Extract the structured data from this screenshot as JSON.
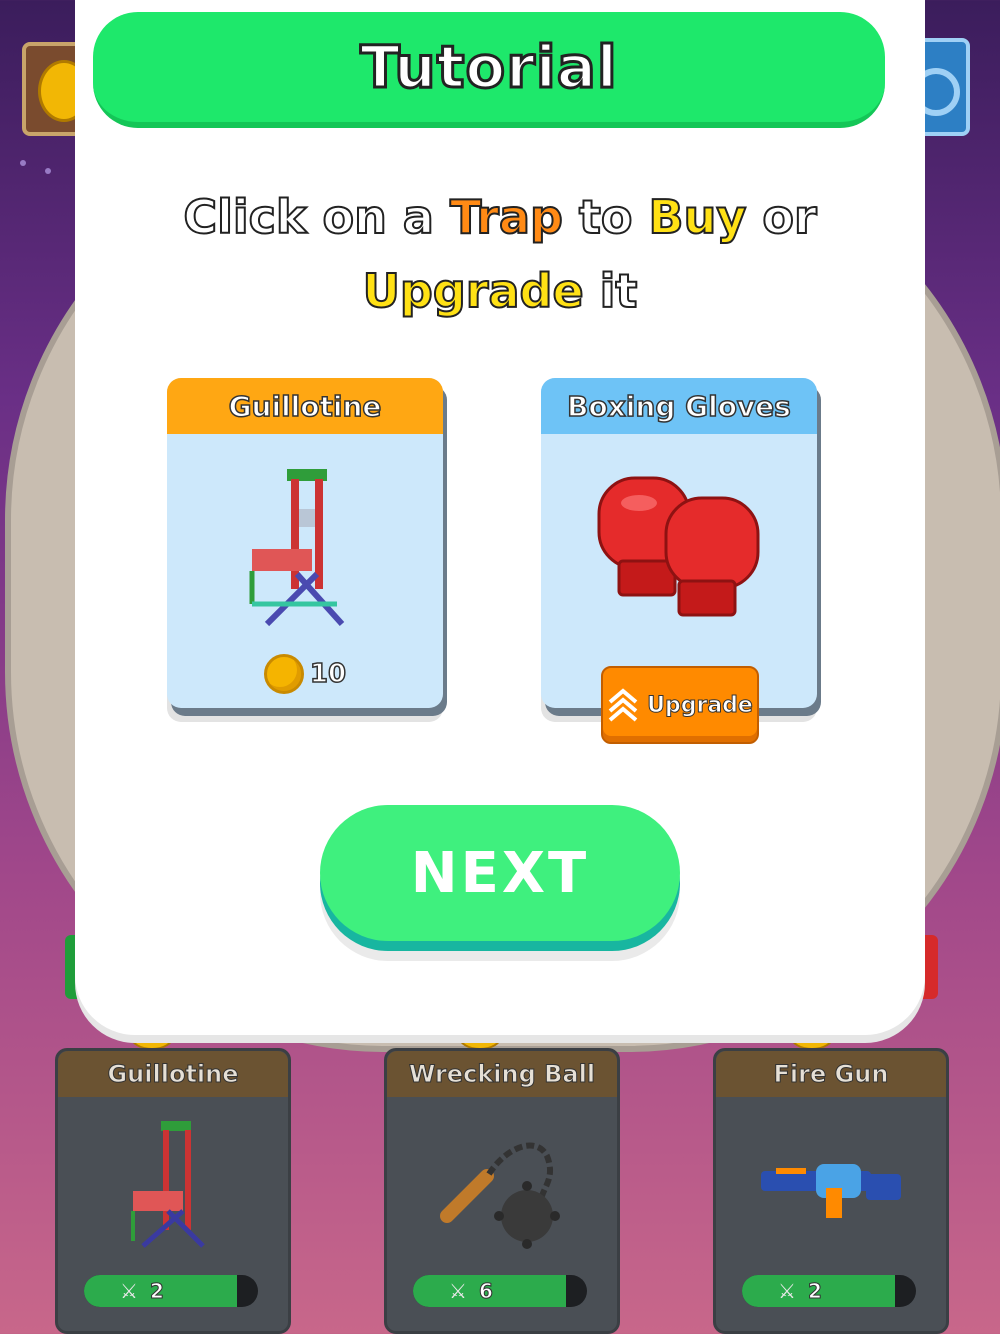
{
  "modal": {
    "title": "Tutorial",
    "instruction": {
      "part1": "Click on a ",
      "trap": "Trap",
      "part2": " to ",
      "buy": "Buy",
      "part3": " or",
      "upgrade": "Upgrade",
      "part4": " it"
    },
    "cards": [
      {
        "name": "Guillotine",
        "price": "10",
        "icon": "coin-icon"
      },
      {
        "name": "Boxing Gloves",
        "button": "Upgrade",
        "icon": "upgrade-arrows-icon"
      }
    ],
    "next_label": "NEXT"
  },
  "shop": [
    {
      "name": "Guillotine",
      "level": "2",
      "progress": 0.88
    },
    {
      "name": "Wrecking Ball",
      "level": "6",
      "progress": 0.88
    },
    {
      "name": "Fire Gun",
      "level": "2",
      "progress": 0.88
    }
  ],
  "colors": {
    "title_green": "#1ee86b",
    "next_green": "#3ff07e",
    "card_orange": "#ffa713",
    "card_blue": "#6ec3f6",
    "upgrade_orange": "#ff8a00"
  }
}
